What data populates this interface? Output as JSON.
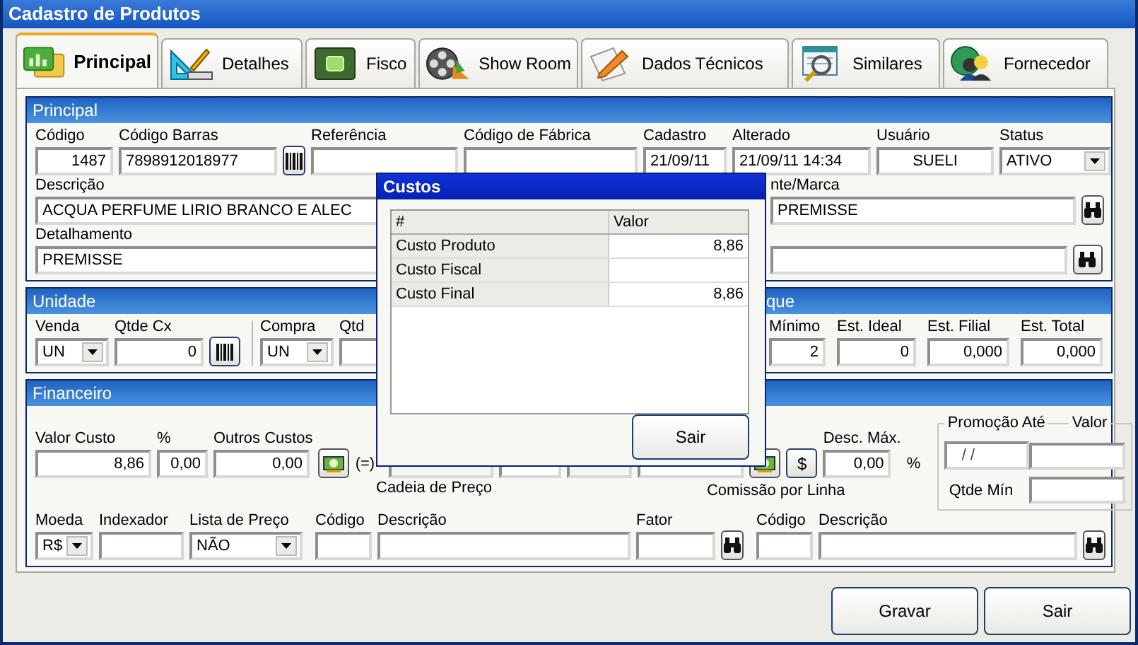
{
  "window": {
    "title": "Cadastro de Produtos"
  },
  "tabs": [
    {
      "label": "Principal",
      "selected": true
    },
    {
      "label": "Detalhes",
      "selected": false
    },
    {
      "label": "Fisco",
      "selected": false
    },
    {
      "label": "Show Room",
      "selected": false
    },
    {
      "label": "Dados Técnicos",
      "selected": false
    },
    {
      "label": "Similares",
      "selected": false
    },
    {
      "label": "Fornecedor",
      "selected": false
    }
  ],
  "principal": {
    "title": "Principal",
    "fields": [
      {
        "kind": "number",
        "label": "Código",
        "value": "1487"
      },
      {
        "kind": "text",
        "label": "Código Barras",
        "value": "7898912018977"
      },
      {
        "kind": "barcode_button"
      },
      {
        "kind": "text",
        "label": "Referência"
      },
      {
        "kind": "text",
        "label": "Código de Fábrica"
      },
      {
        "kind": "text",
        "label": "Cadastro",
        "value": "21/09/11"
      },
      {
        "kind": "text",
        "label": "Alterado",
        "value": "21/09/11 14:34"
      },
      {
        "kind": "center",
        "label": "Usuário",
        "value": "SUELI"
      },
      {
        "kind": "select",
        "label": "Status",
        "value": "ATIVO"
      }
    ],
    "descricao": {
      "kind": "text",
      "label": "Descrição",
      "value": "ACQUA PERFUME LIRIO BRANCO E ALEC"
    },
    "marca": {
      "kind": "text",
      "label": "nte/Marca",
      "value": "PREMISSE"
    },
    "detalhamento": {
      "kind": "text",
      "label": "Detalhamento",
      "value": "PREMISSE"
    }
  },
  "unidade": {
    "title": "Unidade",
    "fields": [
      {
        "kind": "select",
        "label": "Venda",
        "value": "UN"
      },
      {
        "kind": "number",
        "label": "Qtde Cx",
        "value": "0"
      },
      {
        "kind": "barcode_button"
      },
      {
        "kind": "divider"
      },
      {
        "kind": "select",
        "label": "Compra",
        "value": "UN"
      },
      {
        "kind": "text",
        "label": "Qtd"
      }
    ]
  },
  "estoque": {
    "title": "que",
    "fields": [
      {
        "kind": "number",
        "label": "Mínimo",
        "value": "2"
      },
      {
        "kind": "number",
        "label": "Est. Ideal",
        "value": "0"
      },
      {
        "kind": "number",
        "label": "Est. Filial",
        "value": "0,000"
      },
      {
        "kind": "number",
        "label": "Est. Total",
        "value": "0,000"
      }
    ]
  },
  "financeiro": {
    "title": "Financeiro",
    "fields": [
      {
        "kind": "number",
        "label": "Valor Custo",
        "value": "8,86"
      },
      {
        "kind": "number",
        "label": "%",
        "value": "0,00"
      },
      {
        "kind": "number",
        "label": "Outros Custos",
        "value": "0,00"
      },
      {
        "kind": "money_button"
      },
      {
        "kind": "symbol",
        "value": "(=)"
      },
      {
        "kind": "disabled"
      },
      {
        "kind": "number"
      },
      {
        "kind": "disabled"
      },
      {
        "kind": "number"
      },
      {
        "kind": "money_button"
      },
      {
        "kind": "dollar_button",
        "value": "$"
      },
      {
        "kind": "number",
        "label": "Desc. Máx.",
        "value": "0,00"
      },
      {
        "kind": "symbol",
        "value": "%"
      }
    ],
    "cadeia_label": "Cadeia de Preço",
    "comissao_label": "Comissão por Linha",
    "bottom_fields": [
      {
        "kind": "select",
        "label": "Moeda",
        "value": "R$"
      },
      {
        "kind": "text",
        "label": "Indexador"
      },
      {
        "kind": "select",
        "label": "Lista de Preço",
        "value": "NÃO"
      },
      {
        "kind": "text",
        "label": "Código"
      },
      {
        "kind": "text",
        "label": "Descrição"
      },
      {
        "kind": "text",
        "label": "Fator"
      },
      {
        "kind": "search_button"
      },
      {
        "kind": "text",
        "label": "Código"
      },
      {
        "kind": "text",
        "label": "Descrição"
      },
      {
        "kind": "search_button"
      }
    ],
    "promocao": {
      "legend": "Promoção Até",
      "legend_2": "Valor",
      "date": "/ /",
      "qty_label": "Qtde Mín"
    }
  },
  "dialog": {
    "title": "Custos",
    "columns": [
      "#",
      "Valor"
    ],
    "rows": [
      [
        "Custo Produto",
        "8,86"
      ],
      [
        "Custo Fiscal",
        ""
      ],
      [
        "Custo Final",
        "8,86"
      ]
    ],
    "button": "Sair"
  },
  "buttons": [
    {
      "label": "Gravar"
    },
    {
      "label": "Sair"
    }
  ]
}
